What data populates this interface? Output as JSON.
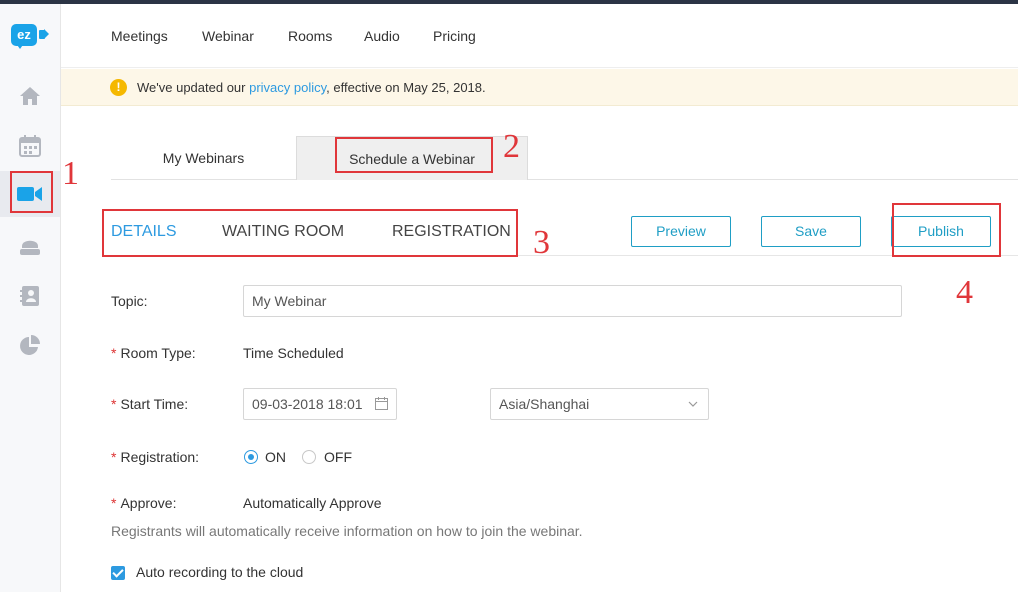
{
  "logo": {
    "text": "ez"
  },
  "sidebar": {
    "items": [
      {
        "icon": "home-icon"
      },
      {
        "icon": "calendar-icon"
      },
      {
        "icon": "video-camera-icon",
        "active": true
      },
      {
        "icon": "meeting-room-icon"
      },
      {
        "icon": "contacts-icon"
      },
      {
        "icon": "pie-chart-icon"
      }
    ]
  },
  "topnav": {
    "items": [
      "Meetings",
      "Webinar",
      "Rooms",
      "Audio",
      "Pricing"
    ]
  },
  "notice": {
    "prefix": "We've updated our ",
    "link": "privacy policy",
    "suffix": ", effective on May 25, 2018."
  },
  "tabs": {
    "my_webinars": "My Webinars",
    "schedule": "Schedule a Webinar"
  },
  "subtabs": {
    "details": "DETAILS",
    "waiting_room": "WAITING ROOM",
    "registration": "REGISTRATION"
  },
  "actions": {
    "preview": "Preview",
    "save": "Save",
    "publish": "Publish"
  },
  "annotations": [
    "1",
    "2",
    "3",
    "4"
  ],
  "form": {
    "topic_label": "Topic:",
    "topic_value": "My Webinar",
    "room_type_label": "Room Type:",
    "room_type_value": "Time Scheduled",
    "start_time_label": "Start Time:",
    "start_time_value": "09-03-2018 18:01",
    "timezone_value": "Asia/Shanghai",
    "registration_label": "Registration:",
    "registration_on": "ON",
    "registration_off": "OFF",
    "registration_selected": "ON",
    "approve_label": "Approve:",
    "approve_value": "Automatically Approve",
    "approve_help": "Registrants will automatically receive information on how to join the webinar.",
    "auto_record_label": "Auto recording to the cloud",
    "auto_record_checked": true
  },
  "colors": {
    "accent": "#2d9ae0",
    "annotation": "#e0363a",
    "brand": "#1aa3e8",
    "button": "#1f9ec5"
  }
}
